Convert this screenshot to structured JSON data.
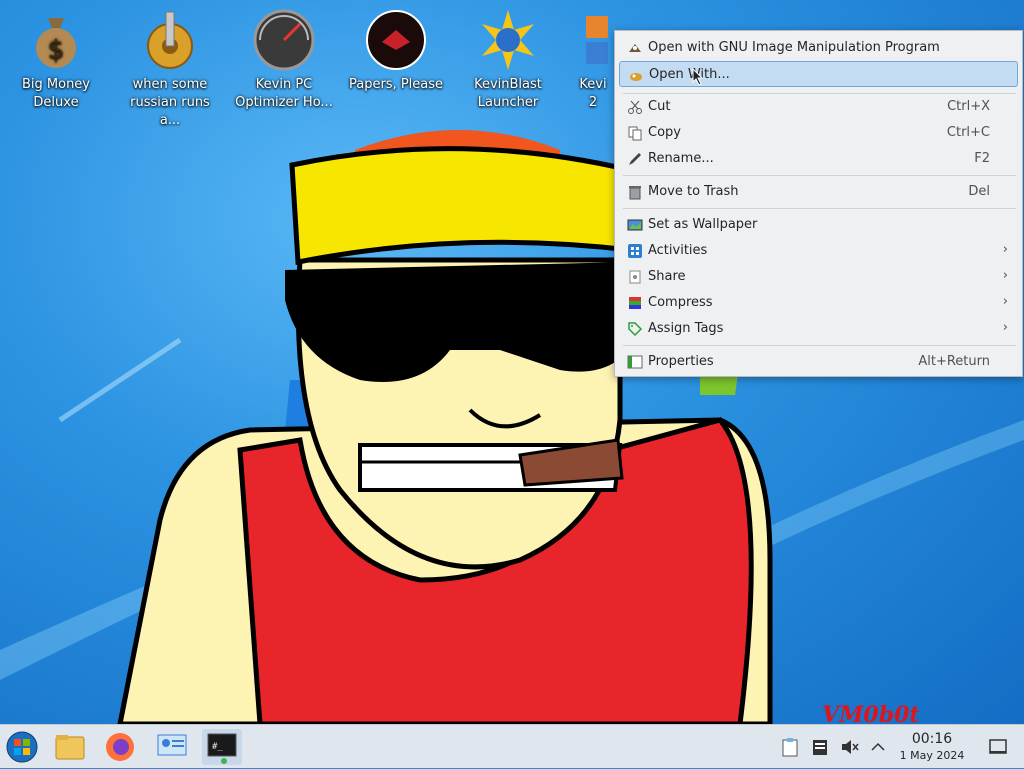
{
  "desktop": {
    "icons": [
      {
        "label": "Big Money\nDeluxe",
        "icon": "money-bag-icon"
      },
      {
        "label": "when some\nrussian runs a...",
        "icon": "gear-icon"
      },
      {
        "label": "Kevin PC\nOptimizer Ho...",
        "icon": "speedometer-icon"
      },
      {
        "label": "Papers, Please",
        "icon": "papers-please-icon"
      },
      {
        "label": "KevinBlast\nLauncher",
        "icon": "starburst-icon"
      },
      {
        "label": "Kevi\n2",
        "icon": "app-icon"
      }
    ],
    "watermark": "VM0b0t"
  },
  "context_menu": {
    "items": [
      {
        "label": "Open with GNU Image Manipulation Program",
        "shortcut": "",
        "icon": "gimp-icon",
        "submenu": false
      },
      {
        "label": "Open With...",
        "shortcut": "",
        "icon": "gimp-icon",
        "submenu": false,
        "highlighted": true
      },
      {
        "label": "Cut",
        "shortcut": "Ctrl+X",
        "icon": "scissors-icon",
        "submenu": false
      },
      {
        "label": "Copy",
        "shortcut": "Ctrl+C",
        "icon": "copy-icon",
        "submenu": false
      },
      {
        "label": "Rename...",
        "shortcut": "F2",
        "icon": "rename-icon",
        "submenu": false
      },
      {
        "label": "Move to Trash",
        "shortcut": "Del",
        "icon": "trash-icon",
        "submenu": false
      },
      {
        "label": "Set as Wallpaper",
        "shortcut": "",
        "icon": "wallpaper-icon",
        "submenu": false
      },
      {
        "label": "Activities",
        "shortcut": "",
        "icon": "activities-icon",
        "submenu": true
      },
      {
        "label": "Share",
        "shortcut": "",
        "icon": "share-icon",
        "submenu": true
      },
      {
        "label": "Compress",
        "shortcut": "",
        "icon": "compress-icon",
        "submenu": true
      },
      {
        "label": "Assign Tags",
        "shortcut": "",
        "icon": "tag-icon",
        "submenu": true
      },
      {
        "label": "Properties",
        "shortcut": "Alt+Return",
        "icon": "properties-icon",
        "submenu": false
      }
    ],
    "submenu_arrow": "›"
  },
  "taskbar": {
    "apps": [
      {
        "icon": "start-menu-icon"
      },
      {
        "icon": "file-manager-icon"
      },
      {
        "icon": "firefox-icon"
      },
      {
        "icon": "system-settings-icon"
      },
      {
        "icon": "terminal-icon",
        "active": true
      }
    ],
    "tray": [
      "clipboard-icon",
      "notes-icon",
      "volume-muted-icon",
      "tray-expand-icon"
    ],
    "clock": {
      "time": "00:16",
      "date": "1 May 2024"
    },
    "show_desktop_icon": "show-desktop-icon"
  },
  "colors": {
    "menu_highlight": "#c3dcf2",
    "taskbar_bg": "#dfe6ed",
    "watermark": "#e0141b"
  }
}
